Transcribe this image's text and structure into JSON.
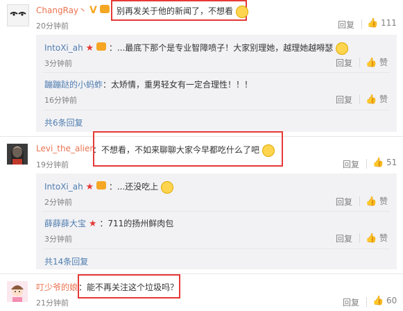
{
  "comments": [
    {
      "user": "ChangRay",
      "suffix": "丶",
      "content": "别再发关于他的新闻了，不想看",
      "time": "20分钟前",
      "reply_label": "回复",
      "likes": "111",
      "replies": [
        {
          "user": "IntoXi_ah",
          "content": "：...最底下那个是专业智障喷子！大家别理她，越理她越嘚瑟",
          "time": "3分钟前",
          "reply_label": "回复",
          "like_label": "赞"
        },
        {
          "user": "蹦蹦跶的小蚂蚱",
          "content": "：太矫情，重男轻女有一定合理性！！！",
          "time": "16分钟前",
          "reply_label": "回复",
          "like_label": "赞"
        }
      ],
      "more": "共6条回复"
    },
    {
      "user": "Levi_the_alien",
      "content": "：不想看，不如来聊聊大家今早都吃什么了吧",
      "time": "19分钟前",
      "reply_label": "回复",
      "likes": "51",
      "replies": [
        {
          "user": "IntoXi_ah",
          "content": "：...还没吃上",
          "time": "2分钟前",
          "reply_label": "回复",
          "like_label": "赞"
        },
        {
          "user": "薛薛薛大宝",
          "content": "：711的扬州鲜肉包",
          "time": "3分钟前",
          "reply_label": "回复",
          "like_label": "赞"
        }
      ],
      "more": "共14条回复"
    },
    {
      "user": "叮少爷的娘",
      "content": "：能不再关注这个垃圾吗？",
      "time": "21分钟前",
      "reply_label": "回复",
      "likes": "60"
    }
  ],
  "colors": {
    "name": "#eb7350",
    "link": "#507daf",
    "highlight": "#e53935",
    "reply_bg": "#f2f2f5"
  }
}
